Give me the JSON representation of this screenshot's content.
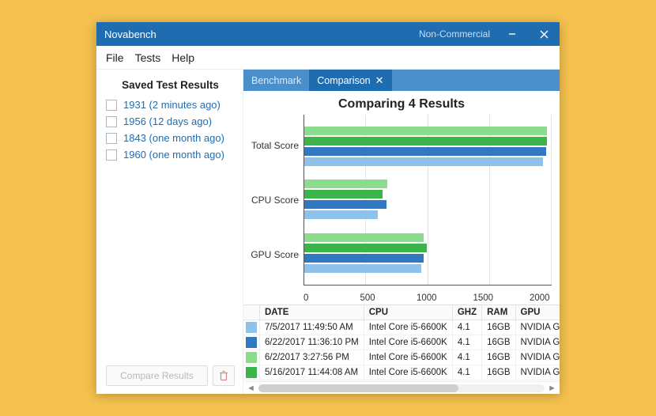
{
  "window": {
    "title": "Novabench",
    "license": "Non-Commercial"
  },
  "menu": {
    "file": "File",
    "tests": "Tests",
    "help": "Help"
  },
  "sidebar": {
    "heading": "Saved Test Results",
    "items": [
      {
        "label": "1931 (2 minutes ago)"
      },
      {
        "label": "1956 (12 days ago)"
      },
      {
        "label": "1843 (one month ago)"
      },
      {
        "label": "1960 (one month ago)"
      }
    ],
    "compare_label": "Compare Results"
  },
  "tabs": {
    "benchmark": "Benchmark",
    "comparison": "Comparison"
  },
  "chart_data": {
    "type": "bar",
    "orientation": "horizontal",
    "title": "Comparing 4 Results",
    "categories": [
      "Total Score",
      "CPU Score",
      "GPU Score"
    ],
    "xlim": [
      0,
      2000
    ],
    "xticks": [
      0,
      500,
      1000,
      1500,
      2000
    ],
    "series": [
      {
        "name": "6/2/2017",
        "color": "#8bdc8c",
        "values": [
          1959,
          674,
          963
        ]
      },
      {
        "name": "5/16/2017",
        "color": "#3bb44a",
        "values": [
          1960,
          631,
          990
        ]
      },
      {
        "name": "6/22/2017",
        "color": "#2f79c2",
        "values": [
          1956,
          664,
          963
        ]
      },
      {
        "name": "7/5/2017",
        "color": "#8fc2ea",
        "values": [
          1931,
          593,
          945
        ]
      }
    ]
  },
  "table": {
    "headers": {
      "date": "DATE",
      "cpu": "CPU",
      "ghz": "GHZ",
      "ram": "RAM",
      "gpu": "GPU"
    },
    "rows": [
      {
        "color": "#8fc2ea",
        "date": "7/5/2017 11:49:50 AM",
        "cpu": "Intel Core i5-6600K",
        "ghz": "4.1",
        "ram": "16GB",
        "gpu": "NVIDIA Gef"
      },
      {
        "color": "#2f79c2",
        "date": "6/22/2017 11:36:10 PM",
        "cpu": "Intel Core i5-6600K",
        "ghz": "4.1",
        "ram": "16GB",
        "gpu": "NVIDIA Gef"
      },
      {
        "color": "#8bdc8c",
        "date": "6/2/2017 3:27:56 PM",
        "cpu": "Intel Core i5-6600K",
        "ghz": "4.1",
        "ram": "16GB",
        "gpu": "NVIDIA Gef"
      },
      {
        "color": "#3bb44a",
        "date": "5/16/2017 11:44:08 AM",
        "cpu": "Intel Core i5-6600K",
        "ghz": "4.1",
        "ram": "16GB",
        "gpu": "NVIDIA Gef"
      }
    ]
  }
}
